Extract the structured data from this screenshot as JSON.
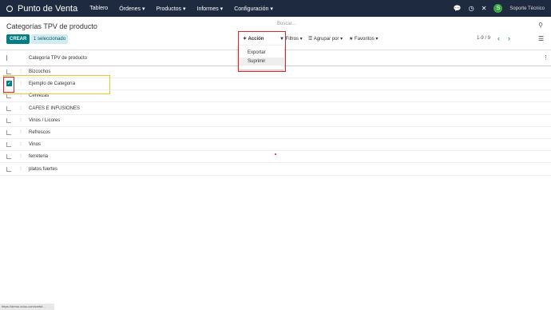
{
  "topbar": {
    "app_name": "Punto de Venta",
    "menu": [
      "Tablero",
      "Órdenes ▾",
      "Productos ▾",
      "Informes ▾",
      "Configuración ▾"
    ],
    "avatar_letter": "S",
    "user_name": "Soporte Técnico"
  },
  "control_panel": {
    "title": "Categorías TPV de producto",
    "search_placeholder": "Buscar...",
    "create_label": "CREAR",
    "selected_label": "1 seleccionado",
    "action_label": "✦ Acción",
    "filters_label": "▼ Filtros ▾",
    "group_label": "☰ Agrupar por ▾",
    "favorites_label": "★ Favoritos ▾",
    "pager": "1-9 / 9"
  },
  "action_menu": {
    "items": [
      "Exportar",
      "Suprimir"
    ]
  },
  "list": {
    "column_header": "Categoría TPV de producto",
    "rows": [
      {
        "label": "Bizcochos",
        "checked": false
      },
      {
        "label": "Ejemplo de Categoría",
        "checked": true
      },
      {
        "label": "Cervezas",
        "checked": false
      },
      {
        "label": "CAFES E INFUSIONES",
        "checked": false
      },
      {
        "label": "Vinos / Licores",
        "checked": false
      },
      {
        "label": "Refrescos",
        "checked": false
      },
      {
        "label": "Vinos",
        "checked": false
      },
      {
        "label": "ferreteria",
        "checked": false
      },
      {
        "label": "platos fuertes",
        "checked": false
      }
    ]
  },
  "statusbar": {
    "url": "https://demo.odoo.com/web#..."
  }
}
